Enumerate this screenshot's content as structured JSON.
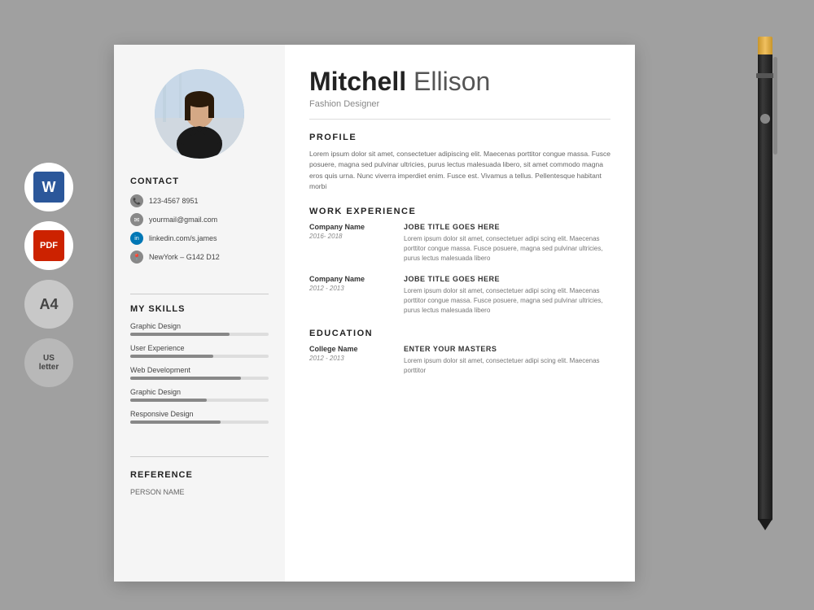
{
  "document": {
    "background_color": "#a0a0a0"
  },
  "left_icons": {
    "word_label": "W",
    "pdf_label": "PDF",
    "a4_label": "A4",
    "us_label": "US",
    "us_sublabel": "letter"
  },
  "cv": {
    "name": {
      "first": "Mitchell",
      "last": "Ellison"
    },
    "job_title": "Fashion Designer",
    "contact": {
      "section_title": "CONTACT",
      "phone": "123-4567 8951",
      "email": "yourmail@gmail.com",
      "linkedin": "linkedin.com/s.james",
      "address": "NewYork – G142 D12"
    },
    "skills": {
      "section_title": "MY SKILLS",
      "items": [
        {
          "name": "Graphic Design",
          "percent": 72
        },
        {
          "name": "User Experience",
          "percent": 60
        },
        {
          "name": "Web Development",
          "percent": 80
        },
        {
          "name": "Graphic Design",
          "percent": 55
        },
        {
          "name": "Responsive Design",
          "percent": 65
        }
      ]
    },
    "reference": {
      "section_title": "REFERENCE",
      "person_label": "PERSON NAME"
    },
    "profile": {
      "section_title": "PROFILE",
      "text": "Lorem ipsum dolor sit amet, consectetuer adipiscing elit. Maecenas porttitor congue massa. Fusce posuere, magna sed pulvinar ultricies, purus lectus malesuada libero, sit amet commodo magna eros quis urna. Nunc viverra imperdiet enim. Fusce est. Vivamus a tellus. Pellentesque habitant morbi"
    },
    "work_experience": {
      "section_title": "WORK EXPERIENCE",
      "entries": [
        {
          "company": "Company Name",
          "dates": "2016- 2018",
          "title": "JOBE TITLE GOES HERE",
          "description": "Lorem ipsum dolor sit amet, consectetuer adipi scing elit. Maecenas porttitor congue massa. Fusce posuere, magna sed pulvinar ultricies, purus lectus malesuada libero"
        },
        {
          "company": "Company Name",
          "dates": "2012 - 2013",
          "title": "JOBE TITLE GOES HERE",
          "description": "Lorem ipsum dolor sit amet, consectetuer adipi scing elit. Maecenas porttitor congue massa. Fusce posuere, magna sed pulvinar ultricies, purus lectus malesuada libero"
        }
      ]
    },
    "education": {
      "section_title": "EDUCATION",
      "entries": [
        {
          "college": "College Name",
          "dates": "2012 - 2013",
          "degree": "ENTER YOUR MASTERS",
          "description": "Lorem ipsum dolor sit amet, consectetuer adipi scing elit. Maecenas porttitor"
        }
      ]
    }
  }
}
